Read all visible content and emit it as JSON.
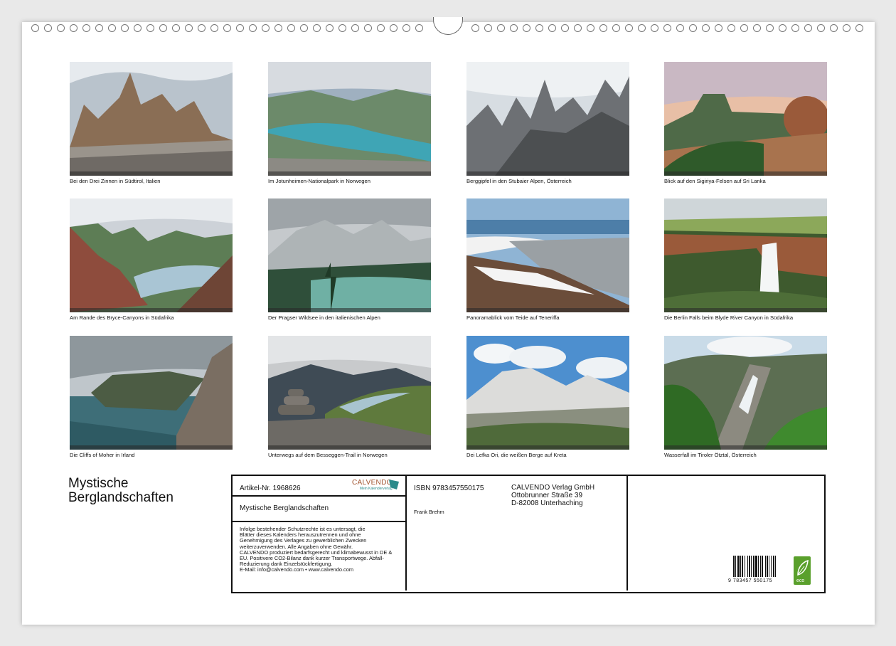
{
  "photos": [
    {
      "caption": "Bei den Drei Zinnen in Südtirol, Italien",
      "scene": "rocky-peaks"
    },
    {
      "caption": "Im Jotunheimen-Nationalpark in Norwegen",
      "scene": "valley-lake"
    },
    {
      "caption": "Berggipfel in den Stubaier Alpen, Österreich",
      "scene": "jagged-peaks"
    },
    {
      "caption": "Blick auf den Sigiriya-Felsen auf Sri Lanka",
      "scene": "rock-plateau"
    },
    {
      "caption": "Am Rande des Bryce-Canyons in Südafrika",
      "scene": "canyon-lake"
    },
    {
      "caption": "Der Pragser Wildsee in den italienischen Alpen",
      "scene": "alpine-lake"
    },
    {
      "caption": "Panoramablick vom Teide auf Teneriffa",
      "scene": "volcano-view"
    },
    {
      "caption": "Die Berlin Falls beim Blyde River Canyon in Südafrika",
      "scene": "waterfall-cliff"
    },
    {
      "caption": "Die Cliffs of Moher in Irland",
      "scene": "sea-cliffs"
    },
    {
      "caption": "Unterwegs auf dem Besseggen-Trail in Norwegen",
      "scene": "cairn-ridge"
    },
    {
      "caption": "Dei Lefka Ori, die weißen Berge auf Kreta",
      "scene": "white-mountains"
    },
    {
      "caption": "Wasserfall im Tiroler Ötztal, Österreich",
      "scene": "green-waterfall"
    }
  ],
  "title": "Mystische Berglandschaften",
  "info": {
    "article": "Artikel-Nr. 1968626",
    "logo_text": "CALVENDO",
    "logo_sub": "Mein Kalenderverlag",
    "product_title": "Mystische Berglandschaften",
    "legal_lines": [
      "Infolge bestehender Schutzrechte ist es untersagt, die",
      "Blätter dieses Kalenders herauszutrennen und ohne",
      "Genehmigung des Verlages zu gewerblichen Zwecken",
      "weiterzuverwenden. Alle Angaben ohne Gewähr.",
      "CALVENDO produziert bedarfsgerecht und klimabewusst in DE &",
      "EU. Positivere CO2-Bilanz dank kurzer Transportwege. Abfall-",
      "Reduzierung dank Einzelstückfertigung.",
      "E-Mail: info@calvendo.com • www.calvendo.com"
    ],
    "isbn": "ISBN 9783457550175",
    "author": "Frank Brehm",
    "publisher_lines": [
      "CALVENDO Verlag GmbH",
      "Ottobrunner Straße 39",
      "D-82008 Unterhaching"
    ],
    "barcode_number": "9 783457 550175",
    "eco_label": "eco"
  },
  "colors": {
    "frame": "#111111",
    "logo": "#a0522d",
    "eco": "#5aa02c"
  }
}
